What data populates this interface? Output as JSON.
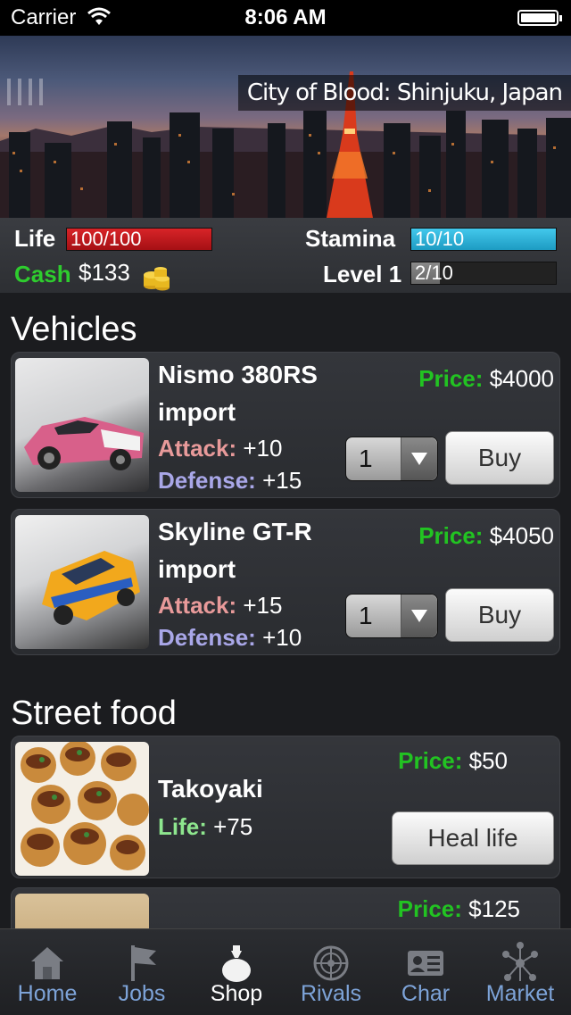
{
  "status_bar": {
    "carrier": "Carrier",
    "time": "8:06 AM"
  },
  "header": {
    "title": "City of Blood: Shinjuku, Japan"
  },
  "stats": {
    "life_label": "Life",
    "life_value": "100/100",
    "life_fraction": 1.0,
    "stamina_label": "Stamina",
    "stamina_value": "10/10",
    "stamina_fraction": 1.0,
    "cash_label": "Cash",
    "cash_value": "$133",
    "level_label": "Level 1",
    "level_value": "2/10",
    "level_fraction": 0.2
  },
  "colors": {
    "life": "#c0181c",
    "stamina": "#2fb0d6",
    "level": "#777777",
    "cash": "#2ecc2e",
    "price_key": "#22c322",
    "attack": "#e89a9a",
    "defense": "#a9a7e8",
    "life_stat": "#8ee68e",
    "tab_inactive": "#7da3d8"
  },
  "sections": {
    "vehicles": {
      "title": "Vehicles",
      "items": [
        {
          "name": "Nismo 380RS import",
          "price_label": "Price:",
          "price": "$4000",
          "attack_label": "Attack:",
          "attack": "+10",
          "defense_label": "Defense:",
          "defense": "+15",
          "qty": "1",
          "button": "Buy"
        },
        {
          "name": "Skyline GT-R import",
          "price_label": "Price:",
          "price": "$4050",
          "attack_label": "Attack:",
          "attack": "+15",
          "defense_label": "Defense:",
          "defense": "+10",
          "qty": "1",
          "button": "Buy"
        }
      ]
    },
    "street_food": {
      "title": "Street food",
      "items": [
        {
          "name": "Takoyaki",
          "price_label": "Price:",
          "price": "$50",
          "life_label": "Life:",
          "life": "+75",
          "button": "Heal life"
        },
        {
          "price_label": "Price:",
          "price": "$125"
        }
      ]
    }
  },
  "tabs": [
    {
      "label": "Home",
      "icon": "home-icon"
    },
    {
      "label": "Jobs",
      "icon": "flag-icon"
    },
    {
      "label": "Shop",
      "icon": "money-bag-icon",
      "active": true
    },
    {
      "label": "Rivals",
      "icon": "radar-icon"
    },
    {
      "label": "Char",
      "icon": "id-card-icon"
    },
    {
      "label": "Market",
      "icon": "network-icon"
    }
  ]
}
